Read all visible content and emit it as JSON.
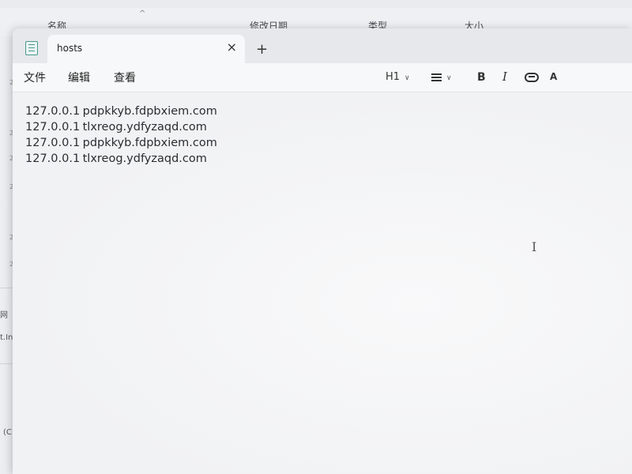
{
  "background_explorer": {
    "columns": [
      {
        "label": "名称"
      },
      {
        "label": "修改日期"
      },
      {
        "label": "类型"
      },
      {
        "label": "大小"
      }
    ],
    "left_fragments": [
      "网",
      "t.Int",
      "(C:)"
    ]
  },
  "notepad": {
    "tab_title": "hosts",
    "close_glyph": "×",
    "new_tab_glyph": "+",
    "menu": [
      "文件",
      "编辑",
      "查看"
    ],
    "format_toolbar": {
      "heading": "H1",
      "bold": "B",
      "italic": "I",
      "spell": "A"
    },
    "lines": [
      {
        "ip": "127.0.0.1",
        "host": "pdpkkyb.fdpbxiem.com"
      },
      {
        "ip": "127.0.0.1",
        "host": "tlxreog.ydfyzaqd.com"
      },
      {
        "ip": "127.0.0.1",
        "host": "pdpkkyb.fdpbxiem.com"
      },
      {
        "ip": "127.0.0.1",
        "host": "tlxreog.ydfyzaqd.com"
      }
    ],
    "cursor_glyph": "I"
  }
}
